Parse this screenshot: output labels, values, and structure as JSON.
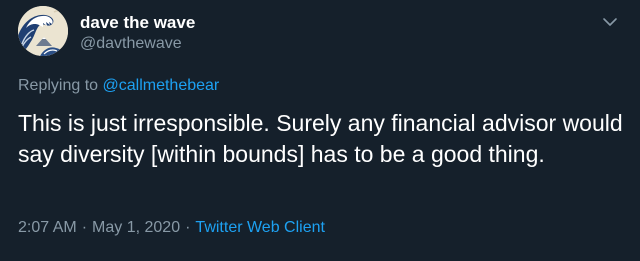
{
  "tweet": {
    "display_name": "dave the wave",
    "handle": "@davthewave",
    "replying_to_prefix": "Replying to",
    "replying_to_handle": "@callmethebear",
    "text": "This is just irresponsible. Surely any financial advisor would say diversity [within bounds] has to be a good thing.",
    "time": "2:07 AM",
    "date": "May 1, 2020",
    "separator": "·",
    "source": "Twitter Web Client"
  },
  "icons": {
    "avatar": "great-wave-avatar",
    "menu": "chevron-down-icon"
  },
  "colors": {
    "background": "#15202b",
    "primary_text": "#ffffff",
    "secondary_text": "#8899a6",
    "accent": "#1da1f2"
  }
}
